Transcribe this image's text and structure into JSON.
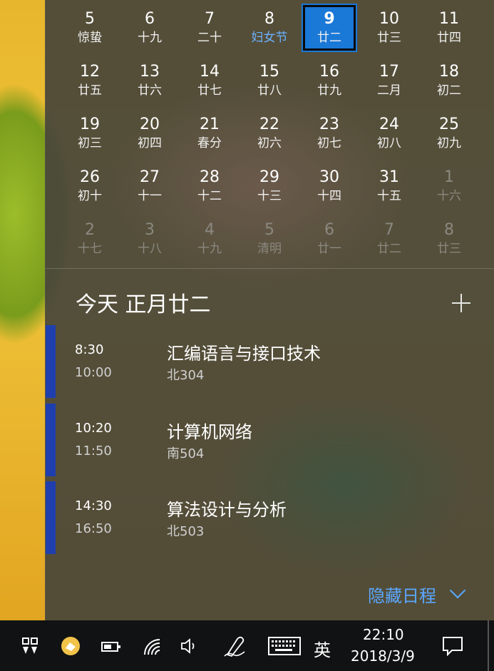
{
  "calendar": {
    "weeks": [
      [
        {
          "day": "5",
          "lunar": "惊蛰"
        },
        {
          "day": "6",
          "lunar": "十九"
        },
        {
          "day": "7",
          "lunar": "二十"
        },
        {
          "day": "8",
          "lunar": "妇女节",
          "festival": true
        },
        {
          "day": "9",
          "lunar": "廿二",
          "today": true
        },
        {
          "day": "10",
          "lunar": "廿三"
        },
        {
          "day": "11",
          "lunar": "廿四"
        }
      ],
      [
        {
          "day": "12",
          "lunar": "廿五"
        },
        {
          "day": "13",
          "lunar": "廿六"
        },
        {
          "day": "14",
          "lunar": "廿七"
        },
        {
          "day": "15",
          "lunar": "廿八"
        },
        {
          "day": "16",
          "lunar": "廿九"
        },
        {
          "day": "17",
          "lunar": "二月"
        },
        {
          "day": "18",
          "lunar": "初二"
        }
      ],
      [
        {
          "day": "19",
          "lunar": "初三"
        },
        {
          "day": "20",
          "lunar": "初四"
        },
        {
          "day": "21",
          "lunar": "春分"
        },
        {
          "day": "22",
          "lunar": "初六"
        },
        {
          "day": "23",
          "lunar": "初七"
        },
        {
          "day": "24",
          "lunar": "初八"
        },
        {
          "day": "25",
          "lunar": "初九"
        }
      ],
      [
        {
          "day": "26",
          "lunar": "初十"
        },
        {
          "day": "27",
          "lunar": "十一"
        },
        {
          "day": "28",
          "lunar": "十二"
        },
        {
          "day": "29",
          "lunar": "十三"
        },
        {
          "day": "30",
          "lunar": "十四"
        },
        {
          "day": "31",
          "lunar": "十五"
        },
        {
          "day": "1",
          "lunar": "十六",
          "dim": true
        }
      ],
      [
        {
          "day": "2",
          "lunar": "十七",
          "dim": true
        },
        {
          "day": "3",
          "lunar": "十八",
          "dim": true
        },
        {
          "day": "4",
          "lunar": "十九",
          "dim": true
        },
        {
          "day": "5",
          "lunar": "清明",
          "dim": true
        },
        {
          "day": "6",
          "lunar": "廿一",
          "dim": true
        },
        {
          "day": "7",
          "lunar": "廿二",
          "dim": true
        },
        {
          "day": "8",
          "lunar": "廿三",
          "dim": true
        }
      ]
    ]
  },
  "agenda": {
    "title": "今天 正月廿二",
    "events": [
      {
        "start": "8:30",
        "end": "10:00",
        "title": "汇编语言与接口技术",
        "location": "北304"
      },
      {
        "start": "10:20",
        "end": "11:50",
        "title": "计算机网络",
        "location": "南504"
      },
      {
        "start": "14:30",
        "end": "16:50",
        "title": "算法设计与分析",
        "location": "北503"
      }
    ],
    "hide_label": "隐藏日程"
  },
  "taskbar": {
    "ime": "英",
    "time": "22:10",
    "date": "2018/3/9",
    "icons": [
      "taskview-icon",
      "app-icon",
      "battery-icon",
      "wifi-icon",
      "volume-icon",
      "pen-icon",
      "keyboard-icon",
      "notification-icon"
    ]
  },
  "colors": {
    "accent": "#1a78d7",
    "event_bar": "#1f3fae",
    "link": "#5aa7ff",
    "festival": "#6ab1ff"
  }
}
